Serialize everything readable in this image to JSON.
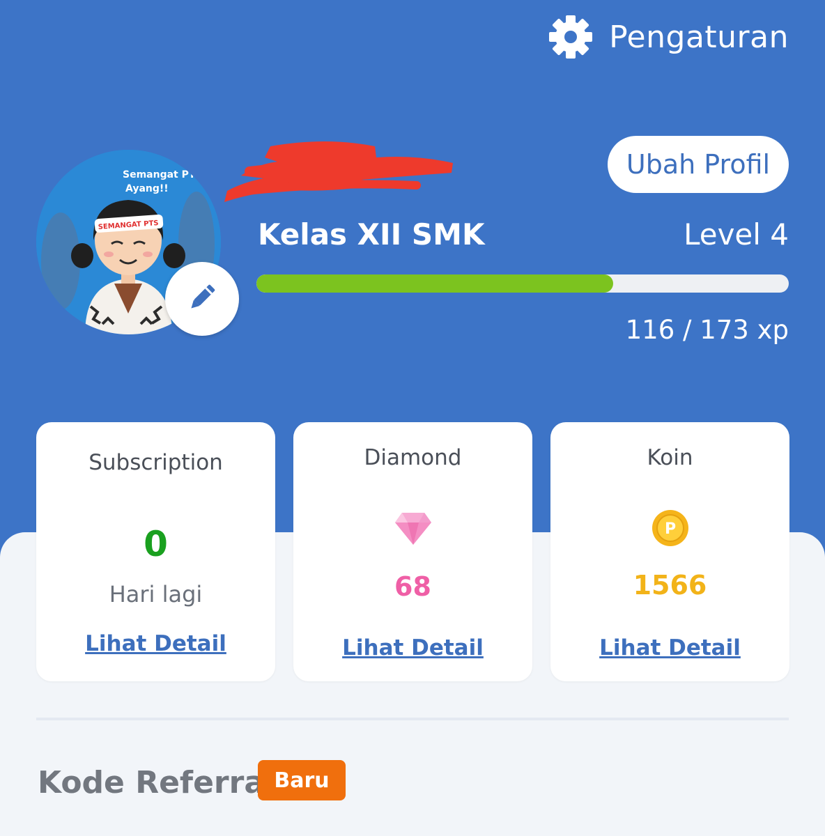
{
  "header": {
    "settings_label": "Pengaturan",
    "settings_icon": "gear-icon"
  },
  "profile": {
    "avatar_caption": "Semangat PTS Ayang!!",
    "avatar_headband": "SEMANGAT PTS",
    "edit_avatar_icon": "pencil-icon",
    "edit_profile_label": "Ubah Profil",
    "class_label": "Kelas XII SMK",
    "level_label": "Level 4",
    "xp_current": 116,
    "xp_max": 173,
    "xp_text": "116 / 173 xp"
  },
  "cards": [
    {
      "title": "Subscription",
      "value": "0",
      "subtitle": "Hari lagi",
      "link": "Lihat Detail",
      "color": "#1aa01f"
    },
    {
      "title": "Diamond",
      "icon": "diamond-icon",
      "value": "68",
      "link": "Lihat Detail",
      "color": "#ef5fa6"
    },
    {
      "title": "Koin",
      "icon": "coin-icon",
      "coin_letter": "P",
      "value": "1566",
      "link": "Lihat Detail",
      "color": "#f2b319"
    }
  ],
  "referral": {
    "title": "Kode Referral",
    "badge": "Baru"
  },
  "colors": {
    "header_bg": "#3d74c7",
    "accent_blue": "#3d6fbd",
    "progress_fill": "#7cc31f",
    "badge_orange": "#f06f0d"
  }
}
